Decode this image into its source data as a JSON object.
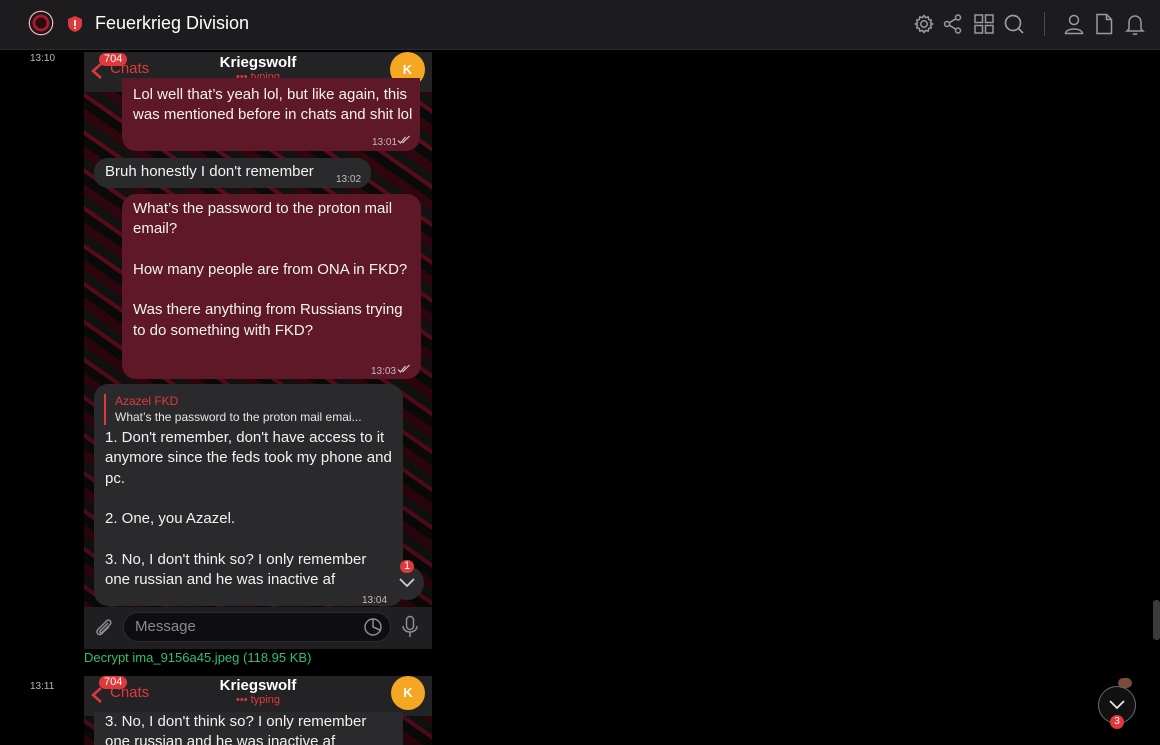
{
  "topbar": {
    "title": "Feuerkrieg Division",
    "icons": [
      "logo-icon",
      "shield-alert-icon",
      "gear-icon",
      "share-icon",
      "grid-icon",
      "search-icon",
      "user-icon",
      "document-icon",
      "bell-icon"
    ]
  },
  "colors": {
    "accent": "#e0393b",
    "outgoing": "#5e1828",
    "incoming": "#2a2a2c",
    "link": "#2ec16f"
  },
  "entries": [
    {
      "timestamp": "13:10",
      "header": {
        "back_label": "Chats",
        "badge": "704",
        "name": "Kriegswolf",
        "status": "••• typing",
        "avatar": "K"
      },
      "messages": [
        {
          "kind": "out",
          "text": "Lol well that’s yeah lol, but like again, this was mentioned before in chats and shit lol",
          "time": "13:01"
        },
        {
          "kind": "in",
          "text": "Bruh honestly I don't remember",
          "time": "13:02"
        },
        {
          "kind": "out",
          "text": "What’s the password to the proton mail email?\n\nHow many people are from ONA in FKD?\n\nWas there anything from Russians trying to do something with FKD?",
          "time": "13:03"
        },
        {
          "kind": "in",
          "reply_name": "Azazel FKD",
          "reply_text": "What’s the password to the proton mail emai...",
          "text": "1. Don't remember, don't have access to it anymore since the feds took my phone and pc.\n\n2. One, you Azazel.\n\n3. No, I don't think so? I only remember one russian and he was inactive af",
          "time": "13:04"
        }
      ],
      "scroll_badge": "1",
      "input_placeholder": "Message"
    },
    {
      "timestamp": "13:11",
      "header": {
        "back_label": "Chats",
        "badge": "704",
        "name": "Kriegswolf",
        "status": "••• typing",
        "avatar": "K"
      },
      "messages": [
        {
          "kind": "in",
          "text": "3. No, I don't think so? I only remember one russian and he was inactive af"
        }
      ]
    }
  ],
  "attachment_link": "Decrypt ima_9156a45.jpeg (118.95 KB)",
  "fab_badge": "3"
}
